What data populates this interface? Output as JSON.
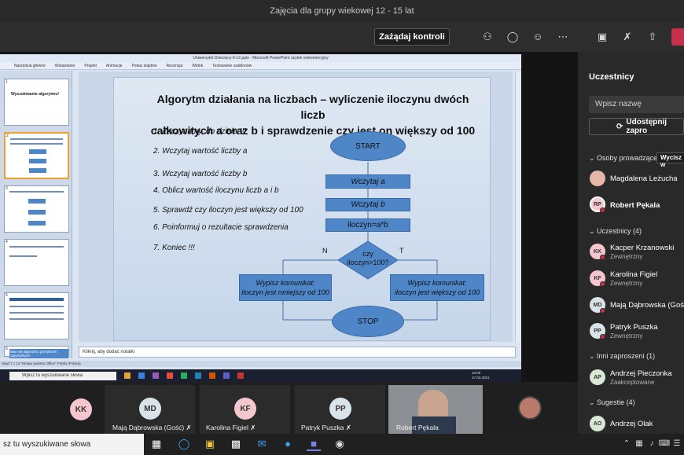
{
  "window": {
    "title": "Zajęcia dla grupy wiekowej 12 - 15 lat"
  },
  "toolbar": {
    "control_label": "Zażądaj kontroli"
  },
  "ppt": {
    "title": "Uniwersytet Dziecięcy-9-12.pptx - Microsoft PowerPoint użytek niekomercyjny",
    "ribbon_tabs": [
      "Narzędzia główne",
      "Wstawianie",
      "Projekt",
      "Animacje",
      "Pokaz slajdów",
      "Recenzja",
      "Widok",
      "Testowanie szablonów"
    ],
    "notes_placeholder": "Kliknij, aby dodać notatki",
    "status": "Slajd 7 z 13    \"Motyw pakietu Office\"    Polski (Polska)",
    "thumb_numbers": [
      "1",
      "2",
      "3",
      "4",
      "5",
      "6"
    ],
    "thumb_title_1": "Wyszukiwanie algorytmu!",
    "thumb_title_6": "Baw się algorytmu przejściem optymalnym!"
  },
  "slide": {
    "title_line1": "Algorytm działania na liczbach – wyliczenie iloczynu dwóch liczb",
    "title_line2": "całkowitych a oraz b i sprawdzenie czy jest on większy od 100",
    "steps": [
      "1. Zaczynamy, do dzieła !!!",
      "2. Wczytaj wartość liczby a",
      "3. Wczytaj wartość liczby b",
      "4. Oblicz wartość iloczynu liczb a i b",
      "5. Sprawdź czy iloczyn jest większy od 100",
      "6. Poinformuj o rezultacie sprawdzenia",
      "7. Koniec !!!"
    ],
    "flow": {
      "start": "START",
      "read_a": "Wczytaj  a",
      "read_b": "Wczytaj b",
      "compute": "iloczyn=a*b",
      "decision_1": "czy",
      "decision_2": "iloczyn>100?",
      "no_label": "N",
      "yes_label": "T",
      "msg_no_1": "Wypisz komunikat:",
      "msg_no_2": "iloczyn jest mniejszy od 100",
      "msg_yes_1": "Wypisz komunikat:",
      "msg_yes_2": "iloczyn jest większy od 100",
      "stop": "STOP"
    }
  },
  "inner_taskbar": {
    "search_placeholder": "Wpisz tu wyszukiwane słowa",
    "time": "10:09",
    "date": "27.03.2021"
  },
  "panel": {
    "title": "Uczestnicy",
    "search_placeholder": "Wpisz nazwę",
    "share_label": "Udostępnij zapro",
    "presenters_label": "Osoby prowadzące (2)",
    "mute_all_label": "Wycisz w",
    "presenters": [
      {
        "name": "Magdalena Leżucha",
        "initials": ""
      },
      {
        "name": "Robert Pękala",
        "initials": "RP"
      }
    ],
    "attendees_label": "Uczestnicy (4)",
    "attendees": [
      {
        "initials": "KK",
        "name": "Kacper Krzanowski",
        "sub": "Zewnętrzny"
      },
      {
        "initials": "KF",
        "name": "Karolina Figiel",
        "sub": "Zewnętrzny"
      },
      {
        "initials": "MD",
        "name": "Mają Dąbrowska (Gość",
        "sub": ""
      },
      {
        "initials": "PP",
        "name": "Patryk Puszka",
        "sub": "Zewnętrzny"
      }
    ],
    "invited_label": "Inni zaproszeni (1)",
    "invited": [
      {
        "initials": "AP",
        "name": "Andrzej Pieczonka",
        "sub": "Zaakceptowane"
      }
    ],
    "suggestions_label": "Sugestie (4)",
    "suggestions": [
      {
        "initials": "AO",
        "name": "Andrzej Olak"
      }
    ]
  },
  "strip": {
    "tiles": [
      {
        "initials": "KK",
        "name": ""
      },
      {
        "initials": "MD",
        "name": "Mają Dąbrowska (Gość)"
      },
      {
        "initials": "KF",
        "name": "Karolina Figiel"
      },
      {
        "initials": "PP",
        "name": "Patryk Puszka"
      },
      {
        "initials": "",
        "name": "Robert Pękala"
      }
    ]
  },
  "taskbar": {
    "search_placeholder": "sz tu wyszukiwane słowa"
  },
  "colors": {
    "accent": "#4e86c8",
    "leave": "#c4314b",
    "avatar_pink": "#f4c7cf"
  }
}
